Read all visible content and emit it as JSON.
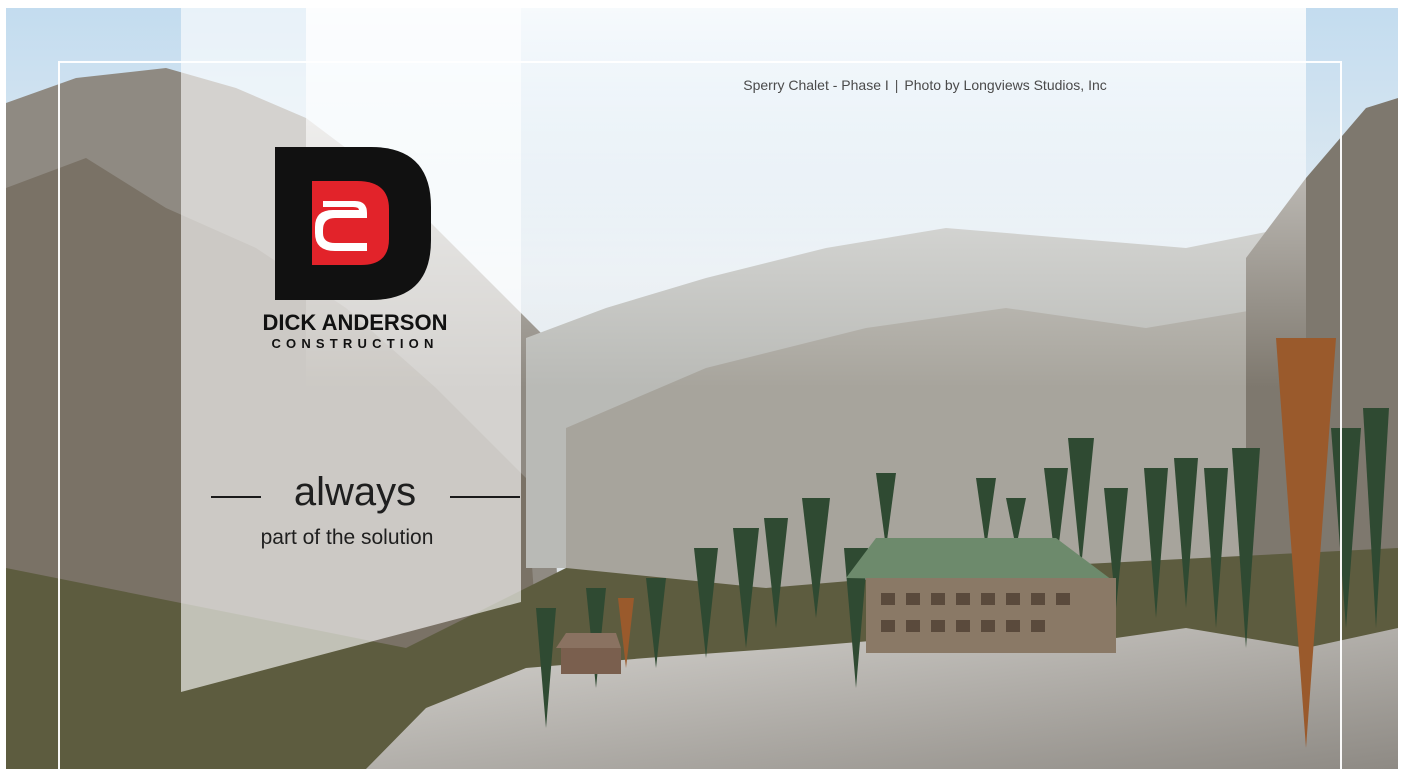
{
  "brand": {
    "name": "DICK ANDERSON",
    "subtitle": "CONSTRUCTION",
    "logo_icon": "dick-anderson-d-logo",
    "colors": {
      "logo_black": "#111111",
      "logo_red": "#e2232a"
    }
  },
  "tagline": {
    "main": "always",
    "sub": "part of the solution"
  },
  "caption": {
    "project": "Sperry Chalet - Phase I",
    "credit": "Photo by Longviews Studios, Inc"
  },
  "photo": {
    "subject": "mountain-chalet-photo"
  }
}
